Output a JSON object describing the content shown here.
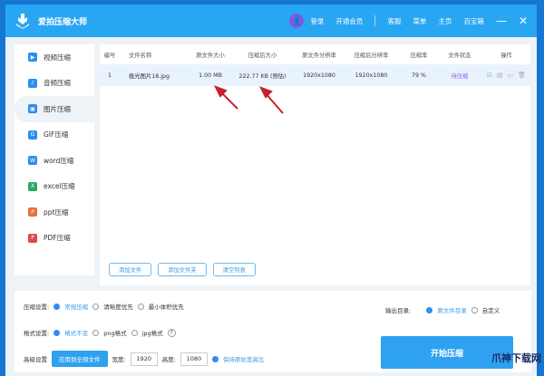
{
  "app": {
    "title": "爱拍压缩大师"
  },
  "header": {
    "login": "登录",
    "vip": "开通会员",
    "service": "客服",
    "menu": "菜单",
    "home": "主页",
    "treasure": "百宝箱",
    "minimize": "—",
    "close": "✕"
  },
  "sidebar": {
    "items": [
      {
        "label": "视频压缩"
      },
      {
        "label": "音频压缩"
      },
      {
        "label": "图片压缩"
      },
      {
        "label": "GIF压缩"
      },
      {
        "label": "word压缩"
      },
      {
        "label": "excel压缩"
      },
      {
        "label": "ppt压缩"
      },
      {
        "label": "PDF压缩"
      }
    ]
  },
  "table": {
    "headers": [
      "编号",
      "文件名称",
      "原文件大小",
      "压缩后大小",
      "原文件分辨率",
      "压缩后分辨率",
      "压缩率",
      "文件状态",
      "操作"
    ],
    "rows": [
      {
        "no": "1",
        "name": "极光图片18.jpg",
        "orig_size": "1.00 MB",
        "new_size": "222.77 KB (预估)",
        "orig_res": "1920x1080",
        "new_res": "1920x1080",
        "ratio": "79 %",
        "status": "待压缩"
      }
    ]
  },
  "buttons": {
    "add_file": "添加文件",
    "add_folder": "添加文件夹",
    "clear": "清空列表",
    "start": "开始压缩",
    "apply_all": "应用到全部文件"
  },
  "settings": {
    "compress_label": "压缩设置:",
    "compress_opts": [
      "常规压缩",
      "清晰度优先",
      "最小体积优先"
    ],
    "format_label": "格式设置:",
    "format_opts": [
      "格式不变",
      "png格式",
      "jpg格式"
    ],
    "help": "?",
    "advanced_label": "高级设置",
    "width_label": "宽度:",
    "width": "1920",
    "height_label": "高度:",
    "height": "1080",
    "keep_ratio": "保持原始宽高比",
    "output_label": "输出目录:",
    "output_opts": [
      "原文件目录",
      "自定义"
    ]
  },
  "watermark": "爪神下载网"
}
